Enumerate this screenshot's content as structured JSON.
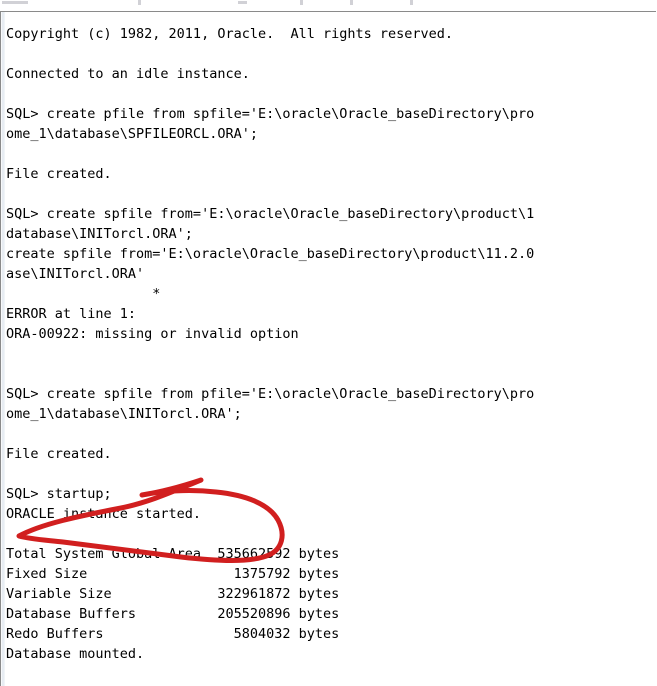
{
  "window": {
    "type": "sqlplus-console",
    "background_color": "#ffffff",
    "text_color": "#000000",
    "border_color": "#8a8a8a"
  },
  "annotation": {
    "kind": "hand-drawn-ellipse",
    "color": "#d11f1f",
    "stroke_width": 5,
    "encircles": "SQL> startup;  /  ORACLE instance started."
  },
  "terminal": {
    "lines": [
      "Copyright (c) 1982, 2011, Oracle.  All rights reserved.",
      "",
      "Connected to an idle instance.",
      "",
      "SQL> create pfile from spfile='E:\\oracle\\Oracle_baseDirectory\\pro",
      "ome_1\\database\\SPFILEORCL.ORA';",
      "",
      "File created.",
      "",
      "SQL> create spfile from='E:\\oracle\\Oracle_baseDirectory\\product\\1",
      "database\\INITorcl.ORA';",
      "create spfile from='E:\\oracle\\Oracle_baseDirectory\\product\\11.2.0",
      "ase\\INITorcl.ORA'",
      "                  *",
      "ERROR at line 1:",
      "ORA-00922: missing or invalid option",
      "",
      "",
      "SQL> create spfile from pfile='E:\\oracle\\Oracle_baseDirectory\\pro",
      "ome_1\\database\\INITorcl.ORA';",
      "",
      "File created.",
      "",
      "SQL> startup;",
      "ORACLE instance started.",
      "",
      "Total System Global Area  535662592 bytes",
      "Fixed Size                  1375792 bytes",
      "Variable Size             322961872 bytes",
      "Database Buffers          205520896 bytes",
      "Redo Buffers                5804032 bytes",
      "Database mounted."
    ]
  }
}
